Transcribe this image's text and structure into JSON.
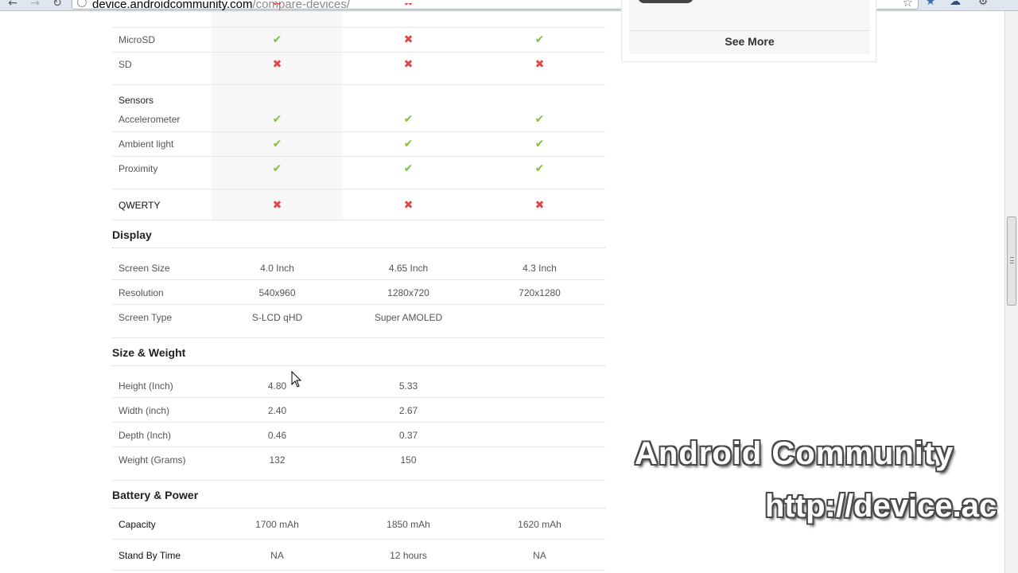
{
  "browser": {
    "url_host": "device.androidcommunity.com",
    "url_path": "/compare-devices/",
    "back_icon": "back-arrow-icon",
    "forward_icon": "forward-arrow-icon",
    "reload_icon": "reload-icon"
  },
  "sidebar_widget": {
    "see_more_label": "See More"
  },
  "storage_rows": [
    {
      "label": "MicroSD",
      "values": [
        "yes",
        "no",
        "yes"
      ]
    },
    {
      "label": "SD",
      "values": [
        "no",
        "no",
        "no"
      ]
    }
  ],
  "sensors": {
    "heading": "Sensors",
    "rows": [
      {
        "label": "Accelerometer",
        "values": [
          "yes",
          "yes",
          "yes"
        ]
      },
      {
        "label": "Ambient light",
        "values": [
          "yes",
          "yes",
          "yes"
        ]
      },
      {
        "label": "Proximity",
        "values": [
          "yes",
          "yes",
          "yes"
        ]
      }
    ]
  },
  "qwerty": {
    "label": "QWERTY",
    "values": [
      "no",
      "no",
      "no"
    ]
  },
  "display": {
    "title": "Display",
    "rows": [
      {
        "label": "Screen Size",
        "values": [
          "4.0 Inch",
          "4.65 Inch",
          "4.3 Inch"
        ]
      },
      {
        "label": "Resolution",
        "values": [
          "540x960",
          "1280x720",
          "720x1280"
        ]
      },
      {
        "label": "Screen Type",
        "values": [
          "S-LCD qHD",
          "Super AMOLED",
          ""
        ]
      }
    ]
  },
  "size_weight": {
    "title": "Size & Weight",
    "rows": [
      {
        "label": "Height (Inch)",
        "values": [
          "4.80",
          "5.33",
          ""
        ]
      },
      {
        "label": "Width (inch)",
        "values": [
          "2.40",
          "2.67",
          ""
        ]
      },
      {
        "label": "Depth (Inch)",
        "values": [
          "0.46",
          "0.37",
          ""
        ]
      },
      {
        "label": "Weight (Grams)",
        "values": [
          "132",
          "150",
          ""
        ]
      }
    ]
  },
  "battery": {
    "title": "Battery & Power",
    "rows": [
      {
        "label": "Capacity",
        "values": [
          "1700 mAh",
          "1850 mAh",
          "1620 mAh"
        ]
      },
      {
        "label": "Stand By Time",
        "values": [
          "NA",
          "12 hours",
          "NA"
        ]
      }
    ]
  },
  "marks": {
    "yes": "✔",
    "no": "✖"
  },
  "colors": {
    "check": "#7cc43a",
    "cross": "#e2474a"
  },
  "watermark": {
    "line1": "Android Community",
    "line2": "http://device.ac"
  }
}
